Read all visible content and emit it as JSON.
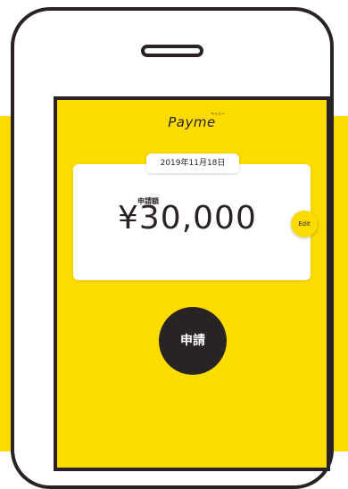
{
  "app": {
    "logo": "Payme",
    "logo_reading": "ペイミー"
  },
  "request": {
    "date": "2019年11月18日",
    "amount_label": "申請額",
    "amount": "¥30,000",
    "edit_label": "Edit",
    "apply_label": "申請"
  },
  "colors": {
    "brand_yellow": "#FCDB00",
    "dark": "#2a2324",
    "card": "#ffffff"
  }
}
